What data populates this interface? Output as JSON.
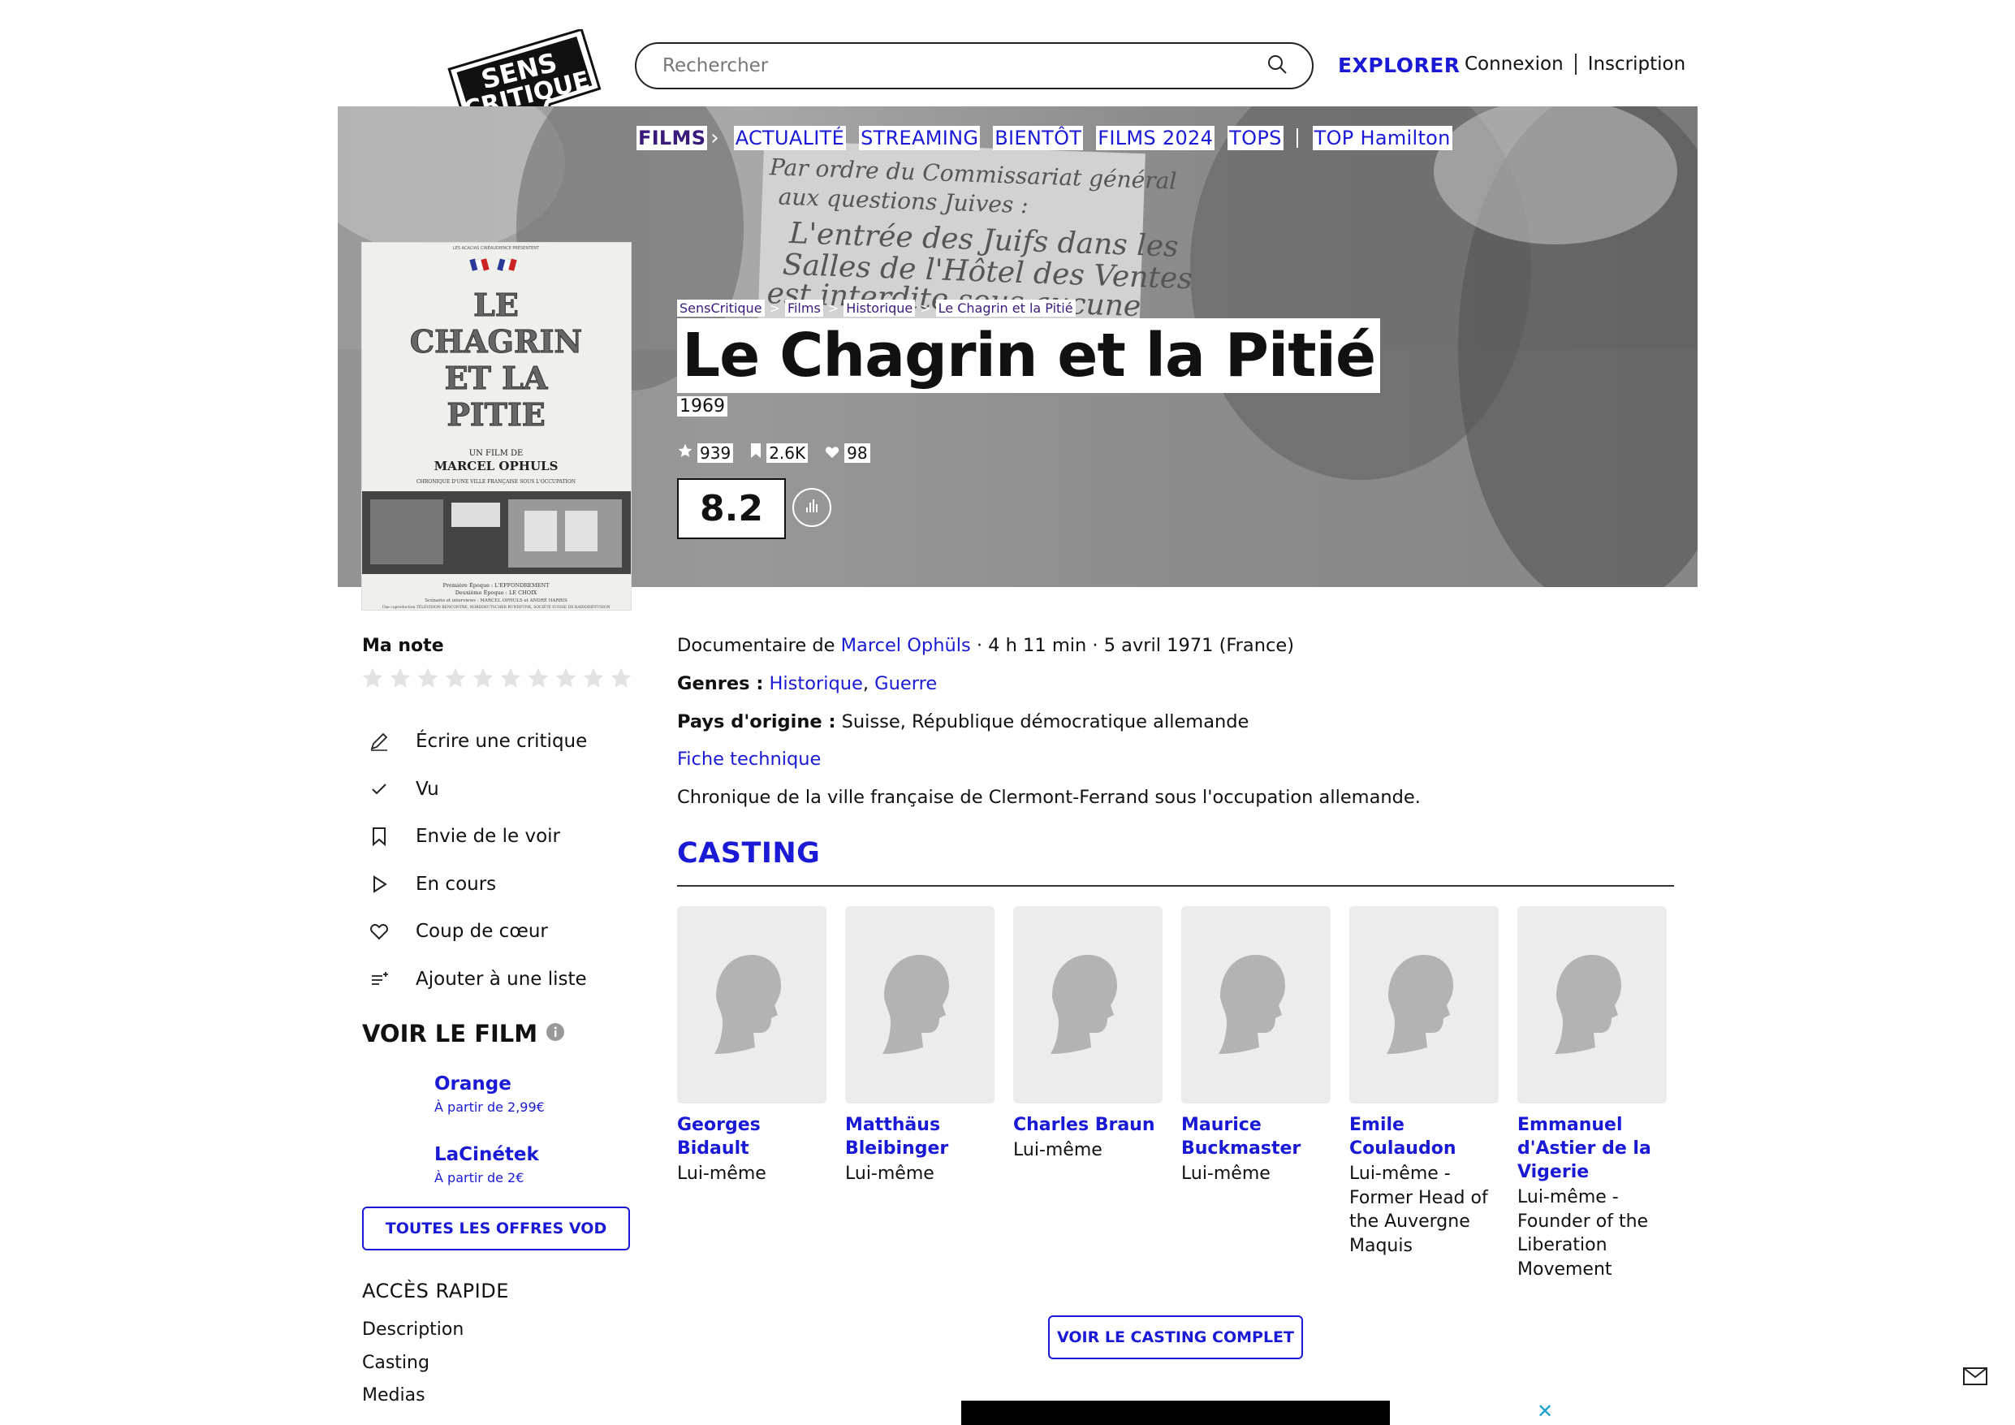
{
  "header": {
    "logo_text_line1": "SENS",
    "logo_text_line2": "CRITIQUE",
    "search_placeholder": "Rechercher",
    "explorer_label": "EXPLORER",
    "login_label": "Connexion",
    "signup_label": "Inscription"
  },
  "nav": {
    "films_label": "FILMS",
    "items": [
      "ACTUALITÉ",
      "STREAMING",
      "BIENTÔT",
      "FILMS 2024",
      "TOPS"
    ],
    "top_label": "TOP Hamilton"
  },
  "hero": {
    "sign_line1": "Par ordre du Commissariat général",
    "sign_line2": "aux questions Juives :",
    "sign_line3": "L'entrée des Juifs dans les",
    "sign_line4": "Salles de l'Hôtel des Ventes",
    "sign_line5": "est interdite sous aucune"
  },
  "poster": {
    "top_line": "LES ACACIAS CINÉAUDIENCE PRÉSENTENT",
    "title1": "LE",
    "title2": "CHAGRIN",
    "title3": "ET LA",
    "title4": "PITIE",
    "film_de": "UN FILM DE",
    "director": "MARCEL OPHULS",
    "tagline": "CHRONIQUE D'UNE VILLE FRANÇAISE SOUS L'OCCUPATION",
    "epoque1": "Première Époque : L'EFFONDREMENT",
    "epoque2": "Deuxième Époque : LE CHOIX",
    "scenario": "Scénario et interviews : MARCEL OPHULS et ANDRÉ HARRIS",
    "production": "Une coproduction TÉLÉVISION RENCONTRE, NORDDEUTSCHER RUNDFUNK, SOCIÉTÉ SUISSE DE RADIODIFFUSION"
  },
  "breadcrumb": [
    "SensCritique",
    "Films",
    "Historique",
    "Le Chagrin et la Pitié"
  ],
  "film": {
    "title": "Le Chagrin et la Pitié",
    "year": "1969",
    "ratings_count": "939",
    "wishlist_count": "2.6K",
    "favorites_count": "98",
    "score": "8.2"
  },
  "left": {
    "ma_note": "Ma note",
    "stars_count": 10,
    "actions": [
      {
        "label": "Écrire une critique",
        "icon": "pencil-icon"
      },
      {
        "label": "Vu",
        "icon": "check-icon"
      },
      {
        "label": "Envie de le voir",
        "icon": "bookmark-icon"
      },
      {
        "label": "En cours",
        "icon": "play-icon"
      },
      {
        "label": "Coup de cœur",
        "icon": "heart-icon"
      },
      {
        "label": "Ajouter à une liste",
        "icon": "list-add-icon"
      }
    ],
    "voir_title": "VOIR LE FILM",
    "vod": [
      {
        "name": "Orange",
        "price": "À partir de 2,99€"
      },
      {
        "name": "LaCinétek",
        "price": "À partir de 2€"
      }
    ],
    "vod_button": "TOUTES LES OFFRES VOD",
    "acces_title": "ACCÈS RAPIDE",
    "acces_items": [
      "Description",
      "Casting",
      "Medias"
    ]
  },
  "info": {
    "doc_prefix": "Documentaire de",
    "director": "Marcel Ophüls",
    "doc_suffix": "· 4 h 11 min · 5 avril 1971 (France)",
    "genres_label": "Genres :",
    "genre1": "Historique",
    "genre_sep": ",",
    "genre2": "Guerre",
    "pays_label": "Pays d'origine :",
    "pays_value": "Suisse, République démocratique allemande",
    "fiche": "Fiche technique",
    "synopsis": "Chronique de la ville française de Clermont-Ferrand sous l'occupation allemande."
  },
  "casting": {
    "title": "CASTING",
    "members": [
      {
        "name": "Georges Bidault",
        "role": "Lui-même"
      },
      {
        "name": "Matthäus Bleibinger",
        "role": "Lui-même"
      },
      {
        "name": "Charles Braun",
        "role": "Lui-même"
      },
      {
        "name": "Maurice Buckmaster",
        "role": "Lui-même"
      },
      {
        "name": "Emile Coulaudon",
        "role": "Lui-même - Former Head of the Auvergne Maquis"
      },
      {
        "name": "Emmanuel d'Astier de la Vigerie",
        "role": "Lui-même - Founder of the Liberation Movement"
      }
    ],
    "button": "VOIR LE CASTING COMPLET"
  },
  "ad": {
    "close": "✕"
  },
  "colors": {
    "accent": "#1a1ad6",
    "nav_active": "#3a1a7a",
    "placeholder_bg": "#ececec"
  }
}
